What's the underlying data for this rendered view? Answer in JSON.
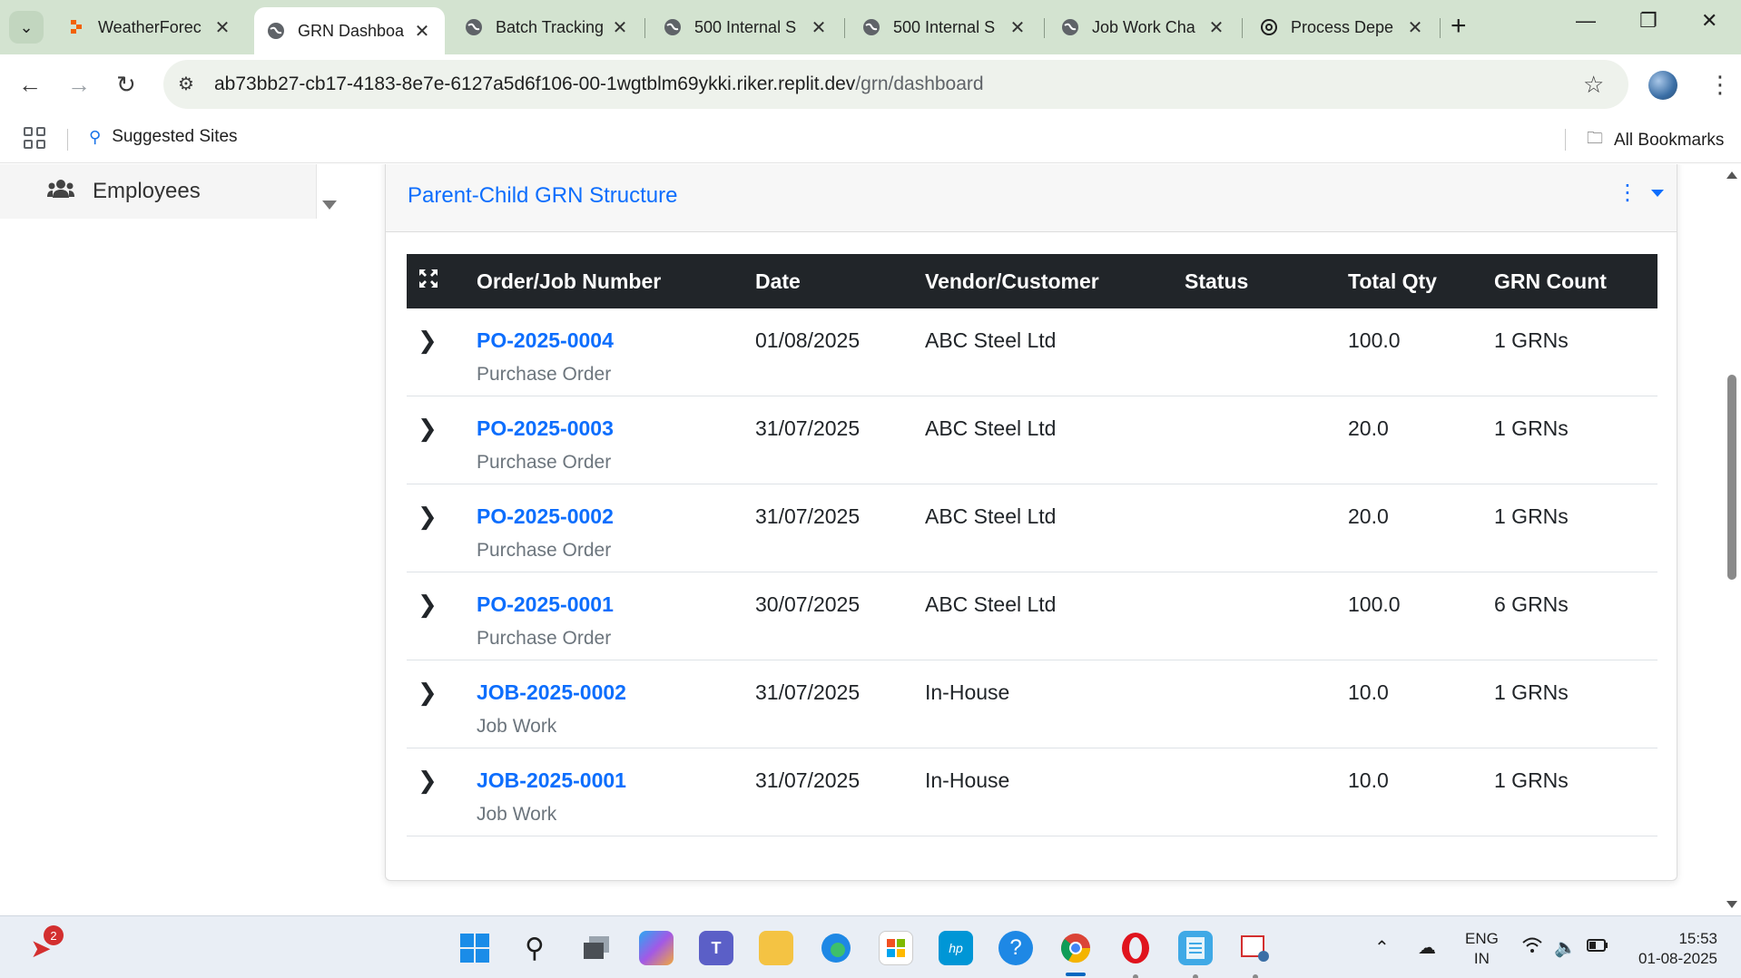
{
  "browser": {
    "tabs": [
      {
        "title": "WeatherForec",
        "favicon": "replit-icon"
      },
      {
        "title": "GRN Dashboa",
        "favicon": "globe-icon",
        "active": true
      },
      {
        "title": "Batch Tracking",
        "favicon": "globe-icon"
      },
      {
        "title": "500 Internal S",
        "favicon": "globe-icon"
      },
      {
        "title": "500 Internal S",
        "favicon": "globe-icon"
      },
      {
        "title": "Job Work Cha",
        "favicon": "globe-icon"
      },
      {
        "title": "Process Depe",
        "favicon": "openai-icon"
      }
    ],
    "url_host": "ab73bb27-cb17-4183-8e7e-6127a5d6f106-00-1wgtblm69ykki.riker.replit.dev",
    "url_path": "/grn/dashboard",
    "bookmarks": {
      "suggested_sites": "Suggested Sites",
      "all_bookmarks": "All Bookmarks"
    }
  },
  "sidebar": {
    "items": [
      {
        "label": "Employees",
        "icon": "users-icon"
      }
    ]
  },
  "card": {
    "title": "Parent-Child GRN Structure",
    "menu_icon": "kebab-menu-icon"
  },
  "table": {
    "columns": [
      "Order/Job Number",
      "Date",
      "Vendor/Customer",
      "Status",
      "Total Qty",
      "GRN Count"
    ],
    "rows": [
      {
        "number": "PO-2025-0004",
        "type": "Purchase Order",
        "date": "01/08/2025",
        "vendor": "ABC Steel Ltd",
        "status": "",
        "qty": "100.0",
        "count": "1 GRNs"
      },
      {
        "number": "PO-2025-0003",
        "type": "Purchase Order",
        "date": "31/07/2025",
        "vendor": "ABC Steel Ltd",
        "status": "",
        "qty": "20.0",
        "count": "1 GRNs"
      },
      {
        "number": "PO-2025-0002",
        "type": "Purchase Order",
        "date": "31/07/2025",
        "vendor": "ABC Steel Ltd",
        "status": "",
        "qty": "20.0",
        "count": "1 GRNs"
      },
      {
        "number": "PO-2025-0001",
        "type": "Purchase Order",
        "date": "30/07/2025",
        "vendor": "ABC Steel Ltd",
        "status": "",
        "qty": "100.0",
        "count": "6 GRNs"
      },
      {
        "number": "JOB-2025-0002",
        "type": "Job Work",
        "date": "31/07/2025",
        "vendor": "In-House",
        "status": "",
        "qty": "10.0",
        "count": "1 GRNs"
      },
      {
        "number": "JOB-2025-0001",
        "type": "Job Work",
        "date": "31/07/2025",
        "vendor": "In-House",
        "status": "",
        "qty": "10.0",
        "count": "1 GRNs"
      }
    ]
  },
  "taskbar": {
    "notification_count": "2",
    "language": "ENG",
    "region": "IN",
    "time": "15:53",
    "date": "01-08-2025"
  },
  "colors": {
    "accent": "#0d6efd",
    "table_header": "#212529",
    "tabbar": "#d3e3d0"
  }
}
